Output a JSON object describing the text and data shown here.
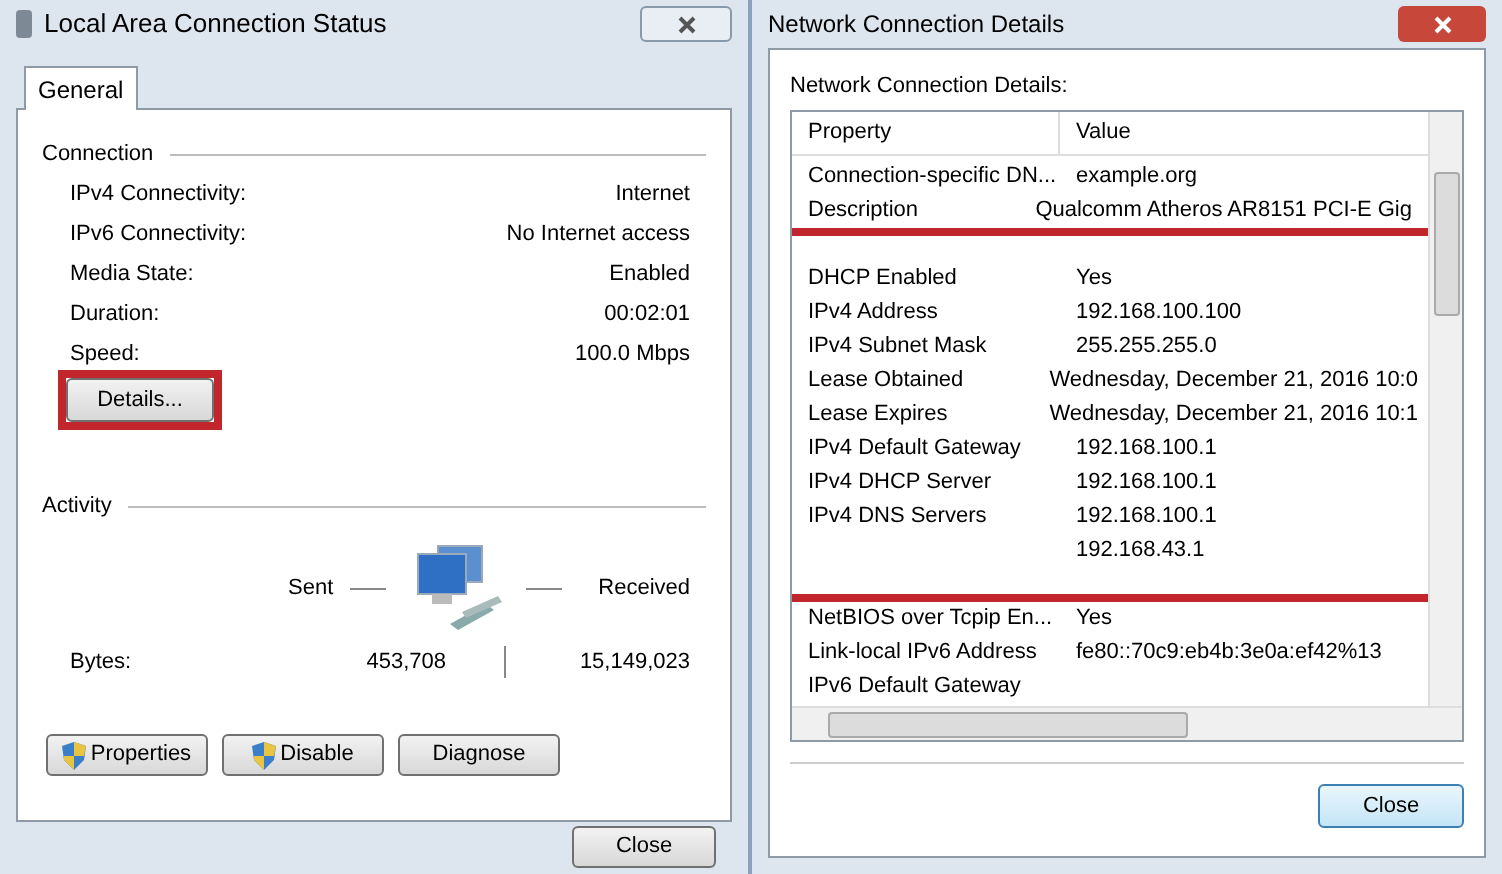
{
  "status_window": {
    "title": "Local Area Connection Status",
    "tabs": [
      {
        "label": "General",
        "selected": true
      }
    ],
    "connection": {
      "heading": "Connection",
      "fields": [
        {
          "label": "IPv4 Connectivity:",
          "value": "Internet"
        },
        {
          "label": "IPv6 Connectivity:",
          "value": "No Internet access"
        },
        {
          "label": "Media State:",
          "value": "Enabled"
        },
        {
          "label": "Duration:",
          "value": "00:02:01"
        },
        {
          "label": "Speed:",
          "value": "100.0 Mbps"
        }
      ],
      "details_button": {
        "label": "Details...",
        "highlighted": true
      }
    },
    "activity": {
      "heading": "Activity",
      "sent_label": "Sent",
      "received_label": "Received",
      "bytes_label": "Bytes:",
      "sent": "453,708",
      "received": "15,149,023"
    },
    "buttons": [
      {
        "label": "Properties",
        "shield": true
      },
      {
        "label": "Disable",
        "shield": true
      },
      {
        "label": "Diagnose",
        "shield": false
      }
    ],
    "close_button": "Close"
  },
  "details_window": {
    "title": "Network Connection Details",
    "label": "Network Connection Details:",
    "columns": [
      "Property",
      "Value"
    ],
    "rows": [
      {
        "property": "Connection-specific DN...",
        "value": "example.org"
      },
      {
        "property": "Description",
        "value": "Qualcomm Atheros AR8151 PCI-E Gig"
      }
    ],
    "highlighted_rows": [
      {
        "property": "DHCP Enabled",
        "value": "Yes"
      },
      {
        "property": "IPv4 Address",
        "value": "192.168.100.100"
      },
      {
        "property": "IPv4 Subnet Mask",
        "value": "255.255.255.0"
      },
      {
        "property": "Lease Obtained",
        "value": "Wednesday, December 21, 2016 10:0"
      },
      {
        "property": "Lease Expires",
        "value": "Wednesday, December 21, 2016 10:1"
      },
      {
        "property": "IPv4 Default Gateway",
        "value": "192.168.100.1"
      },
      {
        "property": "IPv4 DHCP Server",
        "value": "192.168.100.1"
      },
      {
        "property": "IPv4 DNS Servers",
        "value": "192.168.100.1"
      },
      {
        "value": "192.168.43.1"
      }
    ],
    "rows_after": [
      {
        "property": "NetBIOS over Tcpip En...",
        "value": "Yes"
      },
      {
        "property": "Link-local IPv6 Address",
        "value": "fe80::70c9:eb4b:3e0a:ef42%13"
      },
      {
        "property": "IPv6 Default Gateway"
      }
    ],
    "close_button": "Close"
  }
}
